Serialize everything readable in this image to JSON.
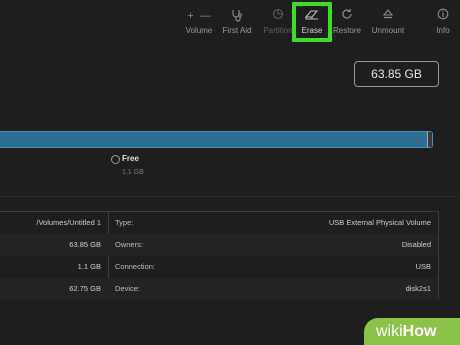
{
  "toolbar": {
    "volume_label": "Volume",
    "first_aid_label": "First Aid",
    "partition_label": "Partition",
    "erase_label": "Erase",
    "restore_label": "Restore",
    "unmount_label": "Unmount",
    "info_label": "Info"
  },
  "capacity": "63.85 GB",
  "usage": {
    "free_label": "Free",
    "free_size": "1.1 GB"
  },
  "info_rows": [
    {
      "left_value": "/Volumes/Untitled 1",
      "key": "Type:",
      "value": "USB External Physical Volume"
    },
    {
      "left_value": "63.85 GB",
      "key": "Owners:",
      "value": "Disabled"
    },
    {
      "left_value": "1.1 GB",
      "key": "Connection:",
      "value": "USB"
    },
    {
      "left_value": "62.75 GB",
      "key": "Device:",
      "value": "disk2s1"
    }
  ],
  "watermark": {
    "prefix": "wiki",
    "suffix": "How"
  },
  "colors": {
    "highlight": "#3fdc29",
    "usage_bar": "#2f6e93",
    "watermark": "#8cc24a"
  }
}
